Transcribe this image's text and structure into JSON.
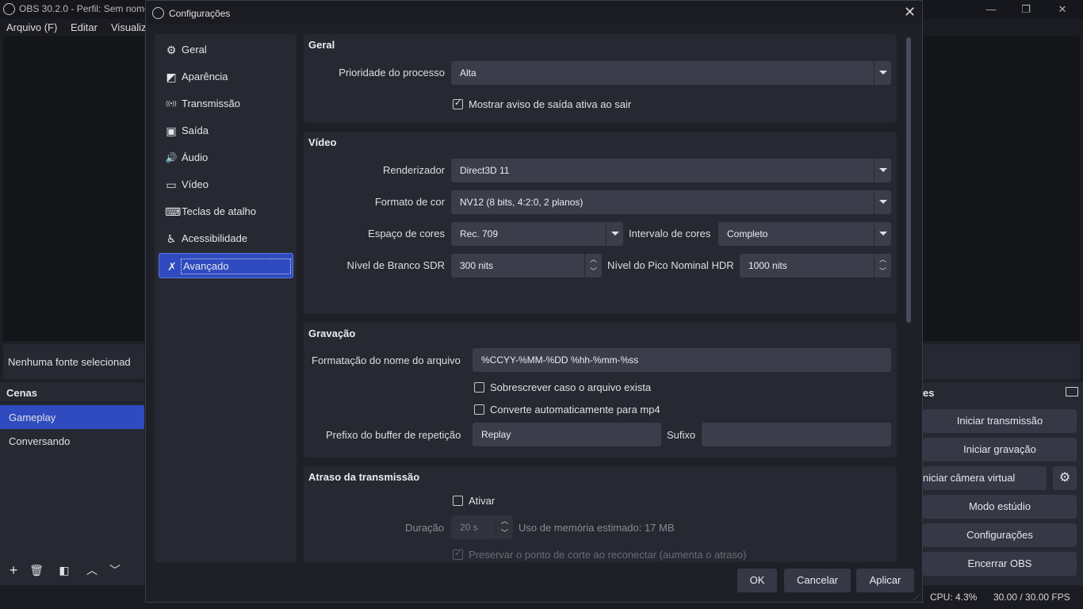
{
  "main_window": {
    "title": "OBS 30.2.0 - Perfil: Sem nome",
    "menu": [
      "Arquivo (F)",
      "Editar",
      "Visualiz"
    ],
    "source_bar_text": "Nenhuma fonte selecionad",
    "scenes": {
      "header": "Cenas",
      "items": [
        "Gameplay",
        "Conversando"
      ],
      "active_index": 0
    },
    "controls": {
      "header_fragment": "es",
      "buttons": [
        "Iniciar transmissão",
        "Iniciar gravação",
        "niciar câmera virtual",
        "Modo estúdio",
        "Configurações",
        "Encerrar OBS"
      ]
    },
    "status": {
      "cpu": "CPU: 4.3%",
      "fps": "30.00 / 30.00 FPS"
    }
  },
  "dialog": {
    "title": "Configurações",
    "nav": [
      {
        "label": "Geral",
        "icon": "gear-icon",
        "glyph": "⚙"
      },
      {
        "label": "Aparência",
        "icon": "appearance-icon",
        "glyph": "◩"
      },
      {
        "label": "Transmissão",
        "icon": "antenna-icon",
        "glyph": "((•))"
      },
      {
        "label": "Saída",
        "icon": "output-icon",
        "glyph": "▣"
      },
      {
        "label": "Áudio",
        "icon": "speaker-icon",
        "glyph": "🔊"
      },
      {
        "label": "Vídeo",
        "icon": "monitor-icon",
        "glyph": "▭"
      },
      {
        "label": "Teclas de atalho",
        "icon": "keyboard-icon",
        "glyph": "⌨"
      },
      {
        "label": "Acessibilidade",
        "icon": "accessibility-icon",
        "glyph": "♿"
      },
      {
        "label": "Avançado",
        "icon": "wrench-icon",
        "glyph": "✗"
      }
    ],
    "active_nav_index": 8,
    "general": {
      "title": "Geral",
      "priority_label": "Prioridade do processo",
      "priority_value": "Alta",
      "exit_warning_label": "Mostrar aviso de saída ativa ao sair",
      "exit_warning_checked": true
    },
    "video": {
      "title": "Vídeo",
      "renderer_label": "Renderizador",
      "renderer_value": "Direct3D 11",
      "color_format_label": "Formato de cor",
      "color_format_value": "NV12 (8 bits, 4:2:0, 2 planos)",
      "color_space_label": "Espaço de cores",
      "color_space_value": "Rec. 709",
      "color_range_label": "Intervalo de cores",
      "color_range_value": "Completo",
      "sdr_white_label": "Nível de Branco SDR",
      "sdr_white_value": "300 nits",
      "hdr_peak_label": "Nível do Pico Nominal HDR",
      "hdr_peak_value": "1000 nits"
    },
    "recording": {
      "title": "Gravação",
      "filename_format_label": "Formatação do nome do arquivo",
      "filename_format_value": "%CCYY-%MM-%DD %hh-%mm-%ss",
      "overwrite_label": "Sobrescrever caso o arquivo exista",
      "overwrite_checked": false,
      "remux_label": "Converte automaticamente para mp4",
      "remux_checked": false,
      "replay_prefix_label": "Prefixo do buffer de repetição",
      "replay_prefix_value": "Replay",
      "suffix_label": "Sufixo",
      "suffix_value": ""
    },
    "stream_delay": {
      "title": "Atraso da transmissão",
      "enable_label": "Ativar",
      "enable_checked": false,
      "duration_label": "Duração",
      "duration_value": "20 s",
      "memory_usage": "Uso de memória estimado: 17 MB",
      "preserve_label": "Preservar o ponto de corte ao reconectar (aumenta o atraso)",
      "preserve_checked": true
    },
    "buttons": {
      "ok": "OK",
      "cancel": "Cancelar",
      "apply": "Aplicar"
    }
  },
  "colors": {
    "accent": "#2f4bbf",
    "background": "#1f2027",
    "panel": "#262832",
    "input": "#3b3d4a"
  }
}
